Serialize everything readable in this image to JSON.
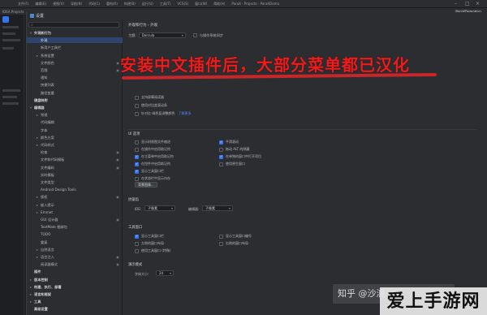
{
  "ide": {
    "menu": [
      "文件(F)",
      "编辑(E)",
      "视图(V)",
      "导航(N)",
      "代码(C)",
      "重构(R)",
      "构建(B)",
      "运行(U)",
      "工具(T)",
      "VCS(S)",
      "窗口(W)",
      "帮助(H)",
      "ParaX - Projects - ParaXDemo"
    ],
    "project_label": "IDEA Projects",
    "run_config": "ParaXDemoApp"
  },
  "dialog": {
    "title": "设置"
  },
  "sidebar": {
    "search_placeholder": "",
    "items": [
      {
        "label": "外观和行为",
        "indent": 0,
        "arrow": "▾",
        "bold": true
      },
      {
        "label": "外观",
        "indent": 1,
        "selected": true
      },
      {
        "label": "新用户工具栏",
        "indent": 1
      },
      {
        "label": "系统设置",
        "indent": 1,
        "arrow": "▸"
      },
      {
        "label": "文件颜色",
        "indent": 1,
        "cfg": true
      },
      {
        "label": "范围",
        "indent": 1,
        "cfg": true
      },
      {
        "label": "通知",
        "indent": 1
      },
      {
        "label": "快捷列表",
        "indent": 1
      },
      {
        "label": "路径变量",
        "indent": 1
      },
      {
        "label": "键盘映射",
        "indent": 0,
        "bold": true
      },
      {
        "label": "编辑器",
        "indent": 0,
        "arrow": "▾",
        "bold": true
      },
      {
        "label": "常规",
        "indent": 1,
        "arrow": "▸"
      },
      {
        "label": "代码编辑",
        "indent": 1
      },
      {
        "label": "字体",
        "indent": 1
      },
      {
        "label": "颜色方案",
        "indent": 1,
        "arrow": "▸"
      },
      {
        "label": "代码样式",
        "indent": 1,
        "arrow": "▸"
      },
      {
        "label": "检查",
        "indent": 1,
        "cfg": true
      },
      {
        "label": "文件和代码模板",
        "indent": 1,
        "cfg": true
      },
      {
        "label": "文件编码",
        "indent": 1,
        "cfg": true
      },
      {
        "label": "实时模板",
        "indent": 1
      },
      {
        "label": "文件类型",
        "indent": 1
      },
      {
        "label": "Android Design Tools",
        "indent": 1
      },
      {
        "label": "版权",
        "indent": 1,
        "arrow": "▸",
        "cfg": true
      },
      {
        "label": "嵌入提示",
        "indent": 1,
        "arrow": "▸"
      },
      {
        "label": "Emmet",
        "indent": 1,
        "arrow": "▸"
      },
      {
        "label": "GUI 设计器",
        "indent": 1,
        "cfg": true
      },
      {
        "label": "TextMate 捆绑包",
        "indent": 1
      },
      {
        "label": "TODO",
        "indent": 1
      },
      {
        "label": "重复",
        "indent": 1
      },
      {
        "label": "自然语言",
        "indent": 1,
        "arrow": "▸"
      },
      {
        "label": "语言注入",
        "indent": 1,
        "arrow": "▸",
        "cfg": true
      },
      {
        "label": "阅读器模式",
        "indent": 1,
        "cfg": true
      },
      {
        "label": "插件",
        "indent": 0,
        "bold": true
      },
      {
        "label": "版本控制",
        "indent": 0,
        "arrow": "▸",
        "bold": true
      },
      {
        "label": "构建、执行、部署",
        "indent": 0,
        "arrow": "▸",
        "bold": true
      },
      {
        "label": "语言和框架",
        "indent": 0,
        "arrow": "▸",
        "bold": true
      },
      {
        "label": "工具",
        "indent": 0,
        "arrow": "▸",
        "bold": true
      },
      {
        "label": "高级设置",
        "indent": 0,
        "bold": true
      }
    ]
  },
  "content": {
    "breadcrumb": "外观和行为  ›  外观",
    "scheme_label": "主题:",
    "scheme_value": "Darcula",
    "sync_os": "与操作系统同步",
    "ui_options_title": "UI 选项",
    "accessibility": [
      {
        "label": "支持屏幕阅读器",
        "on": false
      },
      {
        "label": "使用对比度滚动条",
        "on": false
      },
      {
        "label": "针对红-绿色盲调整颜色",
        "on": false,
        "link": "了解更多"
      }
    ],
    "options_left": [
      {
        "label": "显示树视图文件缩进",
        "on": false
      },
      {
        "label": "在操作中启用助记符",
        "on": false
      },
      {
        "label": "在主菜单中启用助记符",
        "on": true
      },
      {
        "label": "在控件中启用助记符",
        "on": true
      },
      {
        "label": "显示工具窗口栏",
        "on": true
      },
      {
        "label": "在状态栏中显示内存",
        "on": false
      }
    ],
    "options_right": [
      {
        "label": "平滑滚动",
        "on": true
      },
      {
        "label": "拖动 ALT 的隐藏",
        "on": false
      },
      {
        "label": "在单独的窗口中打开项目",
        "on": true
      },
      {
        "label": "使用原生窗口",
        "on": false
      }
    ],
    "background_button": "背景图像...",
    "antialias_title": "抗锯齿",
    "ide_label": "IDE:",
    "ide_value": "子像素",
    "editor_label": "编辑器:",
    "editor_value": "子像素",
    "toolwin_title": "工具窗口",
    "toolwin_left": [
      {
        "label": "显示工具窗口栏",
        "on": true
      },
      {
        "label": "左侧的窗口布局",
        "on": false
      },
      {
        "label": "使用工具窗口 (特殊)",
        "on": false
      }
    ],
    "toolwin_right": [
      {
        "label": "显示工具窗口编号",
        "on": false
      },
      {
        "label": "右侧的窗口布局",
        "on": false
      }
    ],
    "presentation_title": "演示模式",
    "font_size_label": "字体大小:",
    "font_size_value": "24"
  },
  "overlay": {
    "banner": "安装中文插件后，大部分菜单都已汉化"
  },
  "watermark": {
    "zhihu": "知乎 @沙浪",
    "site": "爱上手游网"
  }
}
